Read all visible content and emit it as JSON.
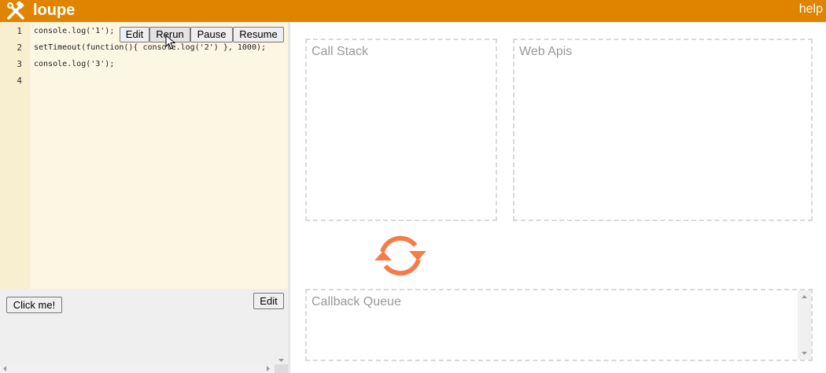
{
  "app": {
    "title": "loupe",
    "help_label": "help",
    "accent_color": "#e08400"
  },
  "editor": {
    "line_numbers": [
      "1",
      "2",
      "3",
      "4"
    ],
    "lines": [
      "console.log('1');",
      "setTimeout(function(){ console.log('2') }, 1000);",
      "console.log('3');",
      ""
    ],
    "buttons": {
      "edit": "Edit",
      "rerun": "Rerun",
      "pause": "Pause",
      "resume": "Resume"
    }
  },
  "preview": {
    "click_me": "Click me!",
    "edit": "Edit"
  },
  "visualizer": {
    "call_stack": "Call Stack",
    "web_apis": "Web Apis",
    "callback_queue": "Callback Queue",
    "loop_color": "#f47c48"
  }
}
